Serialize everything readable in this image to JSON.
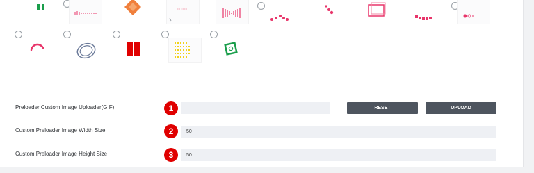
{
  "preloader_options": {
    "icons": [
      "bars-loader-icon",
      "wave-loader-icon",
      "diamond-loader-icon",
      "text-loader-icon",
      "bowtie-loader-icon",
      "dots-loader-icon",
      "scatter-dots-icon",
      "square-frame-icon",
      "dotted-line-icon",
      "pill-dots-icon",
      "spinner-arc-icon",
      "rings-loader-icon",
      "grid-squares-icon",
      "yellow-dots-icon",
      "gear-frame-icon"
    ]
  },
  "uploader": {
    "label": "Preloader Custom Image Uploader(GIF)",
    "badge": "1",
    "value": "",
    "reset_label": "RESET",
    "upload_label": "UPLOAD"
  },
  "width_setting": {
    "label": "Custom Preloader Image Width Size",
    "badge": "2",
    "value": "50"
  },
  "height_setting": {
    "label": "Custom Preloader Image Height Size",
    "badge": "3",
    "value": "50"
  },
  "colors": {
    "badge": "#e00000",
    "button": "#4e555f",
    "field": "#eef0f4",
    "accent_pink": "#e8356a"
  }
}
